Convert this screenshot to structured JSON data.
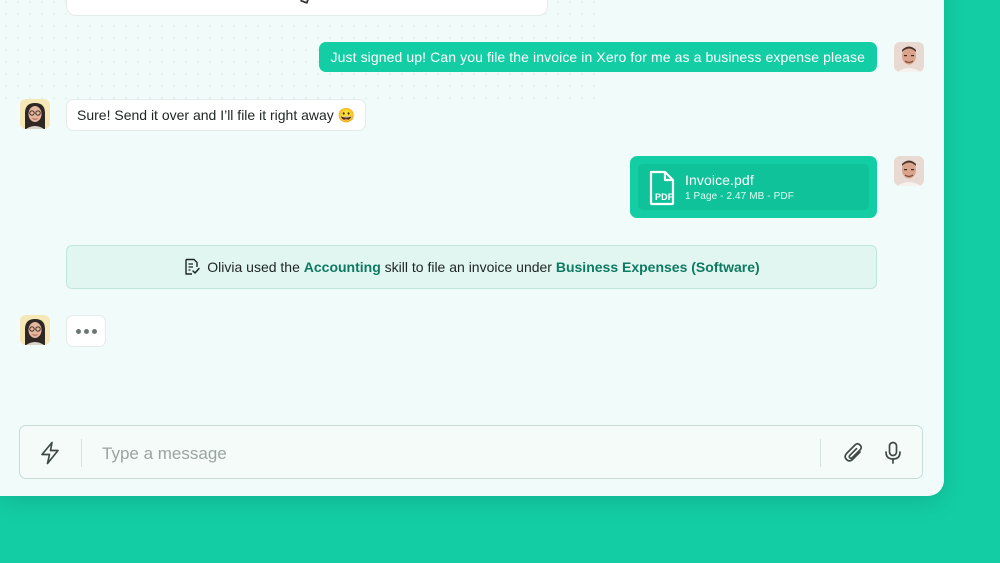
{
  "messages": {
    "user_request": "Just signed up! Can you file the invoice in Xero for me as a business expense please",
    "ai_reply": "Sure! Send it over and I’ll file it right away 😀",
    "attachment": {
      "name": "Invoice.pdf",
      "meta": "1 Page - 2.47 MB - PDF",
      "icon_label": "PDF"
    }
  },
  "skill_banner": {
    "prefix": "Olivia used the ",
    "skill": "Accounting",
    "middle": " skill to file an invoice under ",
    "category": "Business Expenses (Software)"
  },
  "composer": {
    "placeholder": "Type a message"
  },
  "icons": {
    "banner": "document-check-icon",
    "lightning": "lightning-icon",
    "attach": "paperclip-icon",
    "mic": "microphone-icon"
  },
  "colors": {
    "accent": "#13cea5",
    "panel": "#f1fbf9",
    "highlight_text": "#0e7a62"
  }
}
